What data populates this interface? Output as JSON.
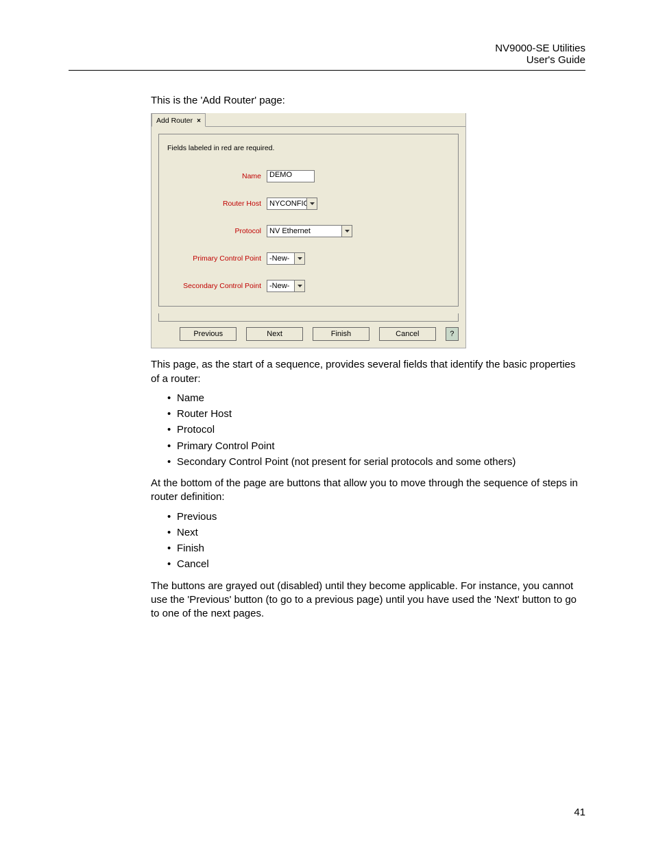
{
  "header": {
    "title": "NV9000-SE Utilities",
    "subtitle": "User's Guide"
  },
  "intro": "This is the 'Add Router' page:",
  "screenshot": {
    "tab": {
      "label": "Add Router",
      "close": "×"
    },
    "required_note": "Fields labeled in red are required.",
    "fields": {
      "name": {
        "label": "Name",
        "value": "DEMO"
      },
      "router_host": {
        "label": "Router Host",
        "value": "NYCONFIG"
      },
      "protocol": {
        "label": "Protocol",
        "value": "NV Ethernet"
      },
      "primary_cp": {
        "label": "Primary Control Point",
        "value": "-New-"
      },
      "secondary_cp": {
        "label": "Secondary Control Point",
        "value": "-New-"
      }
    },
    "buttons": {
      "previous": "Previous",
      "next": "Next",
      "finish": "Finish",
      "cancel": "Cancel",
      "help": "?"
    }
  },
  "para_after": "This page, as the start of a sequence, provides several fields that identify the basic properties of a router:",
  "field_bullets": [
    "Name",
    "Router Host",
    "Protocol",
    "Primary Control Point",
    "Secondary Control Point (not present for serial protocols and some others)"
  ],
  "para_buttons_intro": "At the bottom of the page are buttons that allow you to move through the sequence of steps in router definition:",
  "button_bullets": [
    "Previous",
    "Next",
    "Finish",
    "Cancel"
  ],
  "para_grayed": "The buttons are grayed out (disabled) until they become applicable. For instance, you cannot use the 'Previous' button (to go to a previous page) until you have used the 'Next' button to go to one of the next pages.",
  "page_number": "41"
}
